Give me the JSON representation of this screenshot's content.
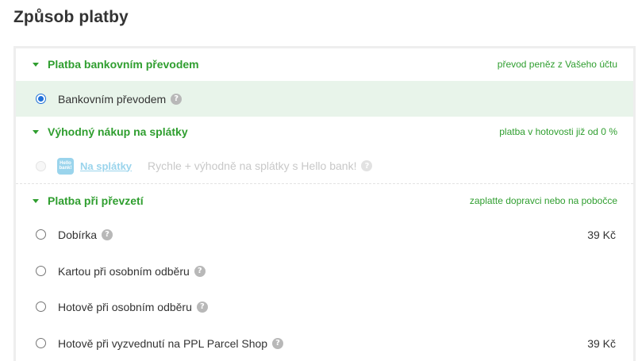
{
  "page": {
    "title": "Způsob platby"
  },
  "groups": [
    {
      "title": "Platba bankovním převodem",
      "note": "převod peněz z Vašeho účtu",
      "options": [
        {
          "label": "Bankovním převodem",
          "help": "?",
          "selected": true
        }
      ]
    },
    {
      "title": "Výhodný nákup na splátky",
      "note": "platba v hotovosti již od 0 %",
      "options": [
        {
          "logo_text": "Hello bank!",
          "brand": "Na splátky",
          "label": "Rychle + výhodně na splátky s Hello bank!",
          "help": "?",
          "disabled": true
        }
      ]
    },
    {
      "title": "Platba při převzetí",
      "note": "zaplatte dopravci nebo na pobočce",
      "options": [
        {
          "label": "Dobírka",
          "help": "?",
          "price": "39 Kč"
        },
        {
          "label": "Kartou při osobním odběru",
          "help": "?"
        },
        {
          "label": "Hotově při osobním odběru",
          "help": "?"
        },
        {
          "label": "Hotově při vyzvednutí na PPL Parcel Shop",
          "help": "?",
          "price": "39 Kč"
        }
      ]
    }
  ],
  "colors": {
    "accent": "#2f9e2f",
    "selected_bg": "#e8f4ea",
    "radio_checked": "#1f6fd8"
  }
}
